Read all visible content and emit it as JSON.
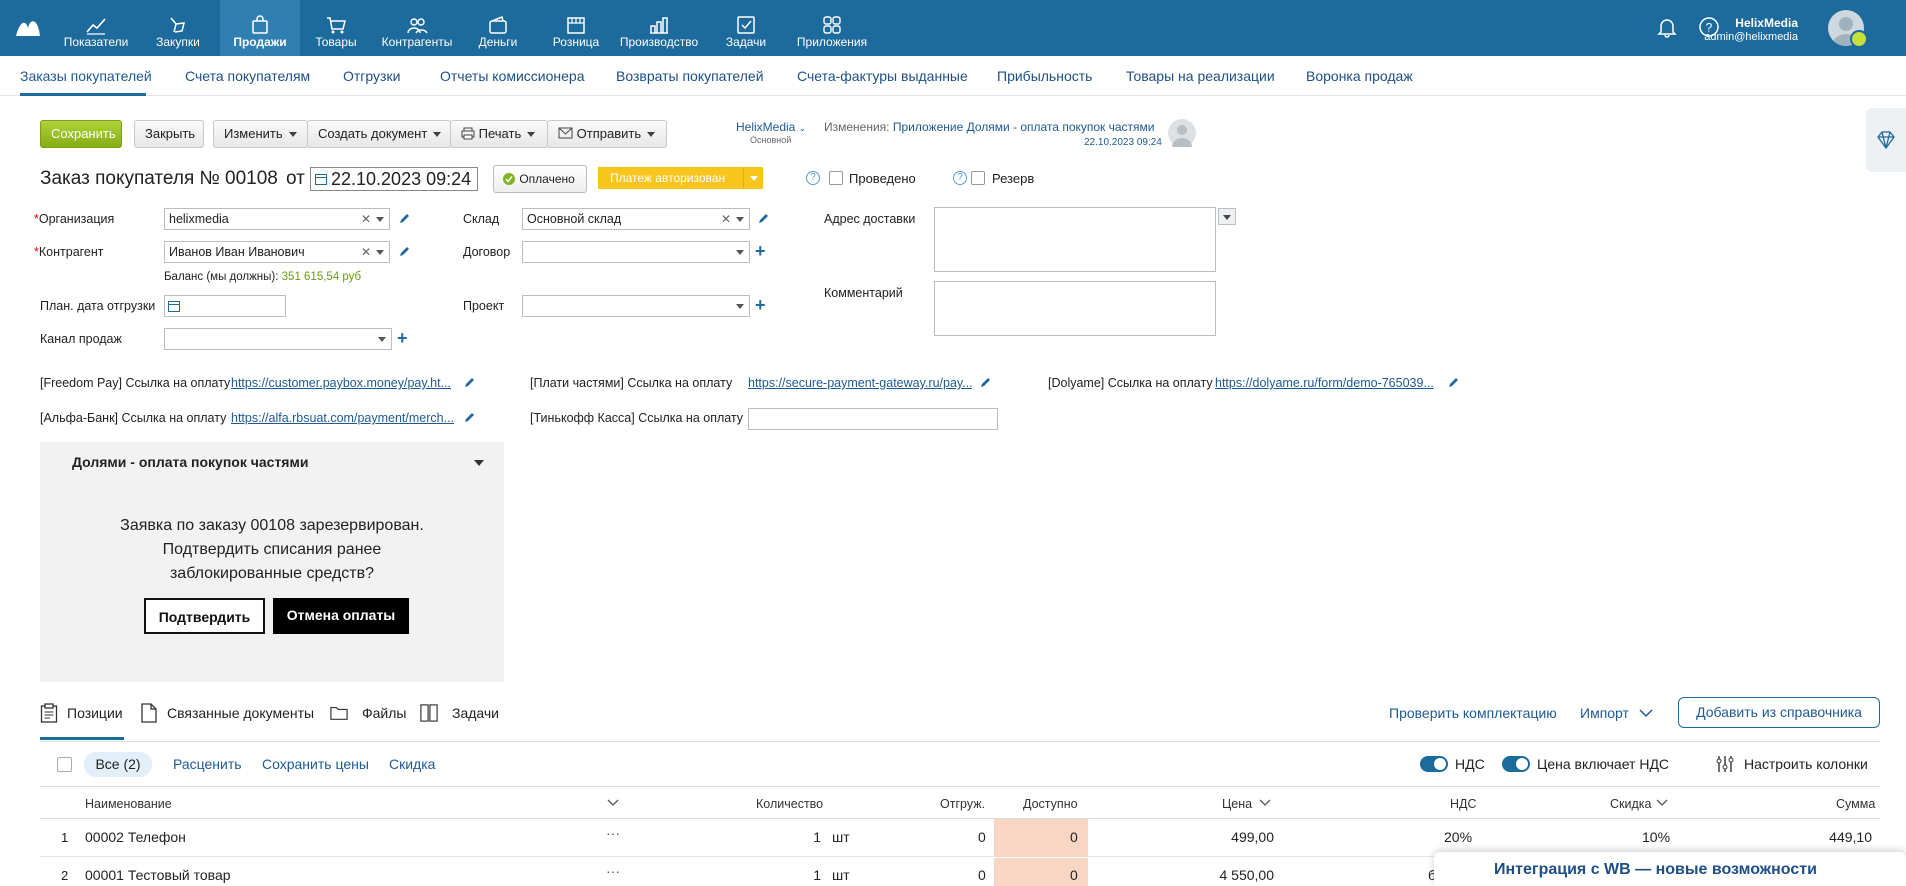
{
  "topnav": {
    "items": [
      {
        "label": "Показатели",
        "icon": "chart-line-icon"
      },
      {
        "label": "Закупки",
        "icon": "purchase-icon"
      },
      {
        "label": "Продажи",
        "icon": "bag-icon"
      },
      {
        "label": "Товары",
        "icon": "cart-icon"
      },
      {
        "label": "Контрагенты",
        "icon": "people-icon"
      },
      {
        "label": "Деньги",
        "icon": "wallet-icon"
      },
      {
        "label": "Розница",
        "icon": "store-icon"
      },
      {
        "label": "Производство",
        "icon": "factory-icon"
      },
      {
        "label": "Задачи",
        "icon": "tasks-icon"
      },
      {
        "label": "Приложения",
        "icon": "apps-icon"
      }
    ],
    "active": "Продажи",
    "user_name": "HelixMedia",
    "user_email": "admin@helixmedia"
  },
  "subnav": {
    "items": [
      "Заказы покупателей",
      "Счета покупателям",
      "Отгрузки",
      "Отчеты комиссионера",
      "Возвраты покупателей",
      "Счета-фактуры выданные",
      "Прибыльность",
      "Товары на реализации",
      "Воронка продаж"
    ]
  },
  "toolbar": {
    "save": "Сохранить",
    "close": "Закрыть",
    "change": "Изменить",
    "create_doc": "Создать документ",
    "print": "Печать",
    "send": "Отправить",
    "org_name": "HelixMedia",
    "org_sub": "Основной",
    "changes_label": "Изменения:",
    "changes_text": "Приложение Долями - оплата покупок частями",
    "changes_date": "22.10.2023 09:24"
  },
  "order": {
    "title": "Заказ покупателя №",
    "number": "00108",
    "from": "от",
    "date": "22.10.2023 09:24",
    "paid_badge": "Оплачено",
    "payment_status": "Платеж авторизован",
    "posted_label": "Проведено",
    "reserve_label": "Резерв"
  },
  "form": {
    "org_label": "Организация",
    "org_value": "helixmedia",
    "contractor_label": "Контрагент",
    "contractor_value": "Иванов Иван Иванович",
    "balance_label": "Баланс (мы должны):",
    "balance_value": "351 615,54 руб",
    "ship_date_label": "План. дата отгрузки",
    "channel_label": "Канал продаж",
    "warehouse_label": "Склад",
    "warehouse_value": "Основной склад",
    "contract_label": "Договор",
    "project_label": "Проект",
    "address_label": "Адрес доставки",
    "comment_label": "Комментарий"
  },
  "payment_links": {
    "freedom_label": "[Freedom Pay] Ссылка на оплату",
    "freedom_url": "https://customer.paybox.money/pay.ht...",
    "alfa_label": "[Альфа-Банк] Ссылка на оплату",
    "alfa_url": "https://alfa.rbsuat.com/payment/merch...",
    "plati_label": "[Плати частями] Ссылка на оплату",
    "plati_url": "https://secure-payment-gateway.ru/pay...",
    "tinkoff_label": "[Тинькофф Касса] Ссылка на оплату",
    "dolyame_label": "[Dolyame] Ссылка на оплату",
    "dolyame_url": "https://dolyame.ru/form/demo-765039..."
  },
  "dolyame_panel": {
    "title": "Долями - оплата покупок частями",
    "line1": "Заявка по заказу 00108 зарезервирован.",
    "line2": "Подтвердить списания ранее",
    "line3": "заблокированные средств?",
    "confirm": "Подтвердить",
    "cancel": "Отмена оплаты"
  },
  "tabs": {
    "positions": "Позиции",
    "related": "Связанные документы",
    "files": "Файлы",
    "tasks": "Задачи",
    "check": "Проверить комплектацию",
    "import": "Импорт",
    "add_from_catalog": "Добавить из справочника"
  },
  "table_controls": {
    "all": "Все (2)",
    "reprice": "Расценить",
    "save_prices": "Сохранить цены",
    "discount": "Скидка",
    "vat": "НДС",
    "price_incl_vat": "Цена включает НДС",
    "configure_columns": "Настроить колонки"
  },
  "table": {
    "headers": {
      "name": "Наименование",
      "qty": "Количество",
      "shipped": "Отгруж.",
      "available": "Доступно",
      "price": "Цена",
      "vat": "НДС",
      "discount": "Скидка",
      "sum": "Сумма"
    },
    "rows": [
      {
        "n": "1",
        "name": "00002 Телефон",
        "qty": "1",
        "unit": "шт",
        "shipped": "0",
        "available": "0",
        "price": "499,00",
        "vat": "20%",
        "discount": "10%",
        "sum": "449,10"
      },
      {
        "n": "2",
        "name": "00001 Тестовый товар",
        "qty": "1",
        "unit": "шт",
        "shipped": "0",
        "available": "0",
        "price": "4 550,00",
        "vat": "бе",
        "discount": "",
        "sum": ""
      }
    ]
  },
  "banner": {
    "text": "Интеграция с WB — новые возможности"
  }
}
